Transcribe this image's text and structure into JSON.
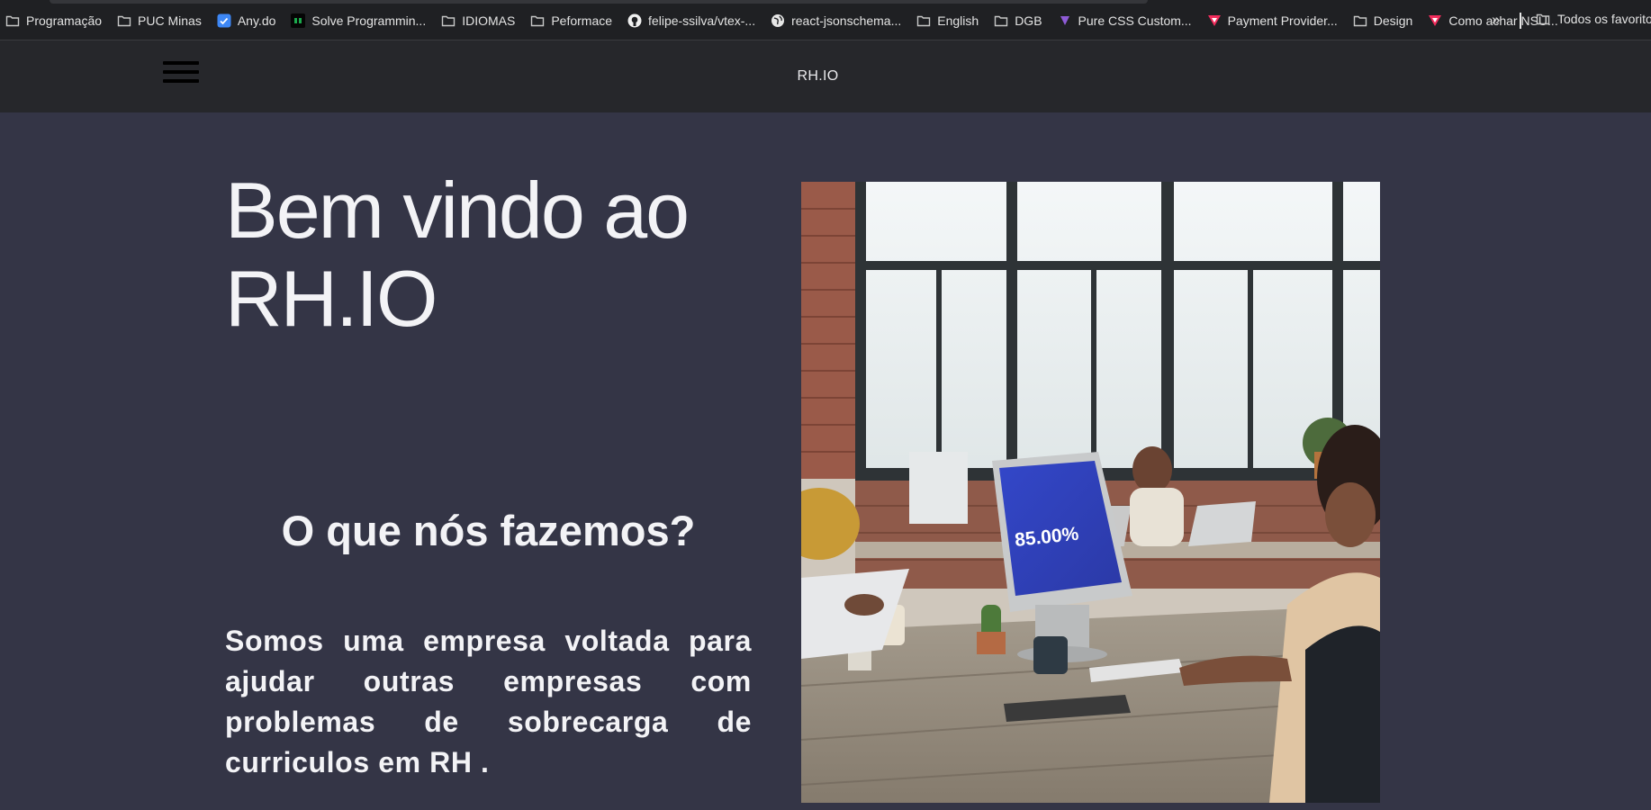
{
  "bookmarks": {
    "items": [
      {
        "label": "Programação",
        "icon": "folder-icon"
      },
      {
        "label": "PUC Minas",
        "icon": "folder-icon"
      },
      {
        "label": "Any.do",
        "icon": "anydo-icon"
      },
      {
        "label": "Solve Programmin...",
        "icon": "hackerrank-icon"
      },
      {
        "label": "IDIOMAS",
        "icon": "folder-icon"
      },
      {
        "label": "Peformace",
        "icon": "folder-icon"
      },
      {
        "label": "felipe-ssilva/vtex-...",
        "icon": "github-icon"
      },
      {
        "label": "react-jsonschema...",
        "icon": "globe-icon"
      },
      {
        "label": "English",
        "icon": "folder-icon"
      },
      {
        "label": "DGB",
        "icon": "folder-icon"
      },
      {
        "label": "Pure CSS Custom...",
        "icon": "site-icon"
      },
      {
        "label": "Payment Provider...",
        "icon": "vtex-icon"
      },
      {
        "label": "Design",
        "icon": "folder-icon"
      },
      {
        "label": "Como achar NSU...",
        "icon": "vtex-icon"
      }
    ],
    "more": "»",
    "all_label": "Todos os favoritos"
  },
  "header": {
    "brand": "RH.IO"
  },
  "main": {
    "hero_line1": "Bem vindo ao",
    "hero_line2": "RH.IO",
    "section_title": "O que nós fazemos?",
    "section_body": "Somos uma empresa voltada para ajudar outras empresas com problemas de sobrecarga de curriculos em RH .",
    "photo_screen_value": "85.00%"
  },
  "colors": {
    "page_bg": "#343546",
    "header_bg": "#26272b",
    "bookmarks_bg": "#1f2023",
    "text": "#f3f3f6",
    "screen_blue": "#3b4fc4"
  }
}
